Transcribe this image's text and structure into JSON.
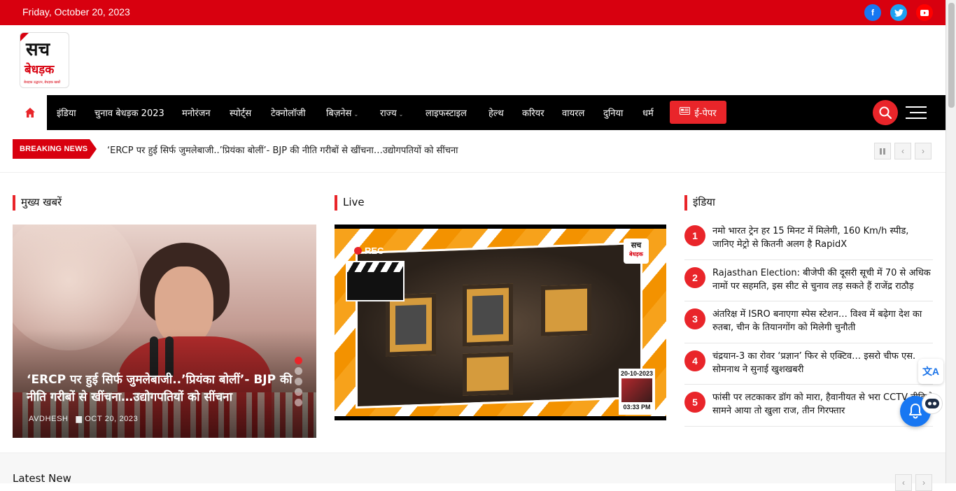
{
  "topbar": {
    "date": "Friday, October 20, 2023",
    "social": [
      {
        "icon": "facebook-icon",
        "glyph": "f",
        "color": "#1877f2"
      },
      {
        "icon": "twitter-icon",
        "glyph": "t",
        "color": "#1da1f2"
      },
      {
        "icon": "youtube-icon",
        "glyph": "▶",
        "color": "#ff0000"
      }
    ]
  },
  "logo": {
    "line1": "सच",
    "line2": "बेधड़क",
    "tagline": "बेधड़क उद्घाटन, बेधड़क खबरें"
  },
  "nav": {
    "items": [
      "इंडिया",
      "चुनाव बेधड़क 2023",
      "मनोरंजन",
      "स्पोर्ट्स",
      "टेक्नोलॉजी",
      "बिज़नेस",
      "राज्य",
      "लाइफस्टाइल",
      "हेल्थ",
      "करियर",
      "वायरल",
      "दुनिया",
      "धर्म"
    ],
    "epaper": "ई-पेपर",
    "accent": "#e9252a"
  },
  "breaking": {
    "label": "BREAKING NEWS",
    "text": "‘ERCP पर हुई सिर्फ जुमलेबाजी..’प्रियंका बोलीं’- BJP की नीति गरीबों से खींचना…उद्योगपतियों को सींचना"
  },
  "sections": {
    "main": "मुख्य खबरें",
    "live": "Live",
    "india": "इंडिया"
  },
  "hero": {
    "title": "‘ERCP पर हुई सिर्फ जुमलेबाजी..’प्रियंका बोलीं’- BJP की नीति गरीबों से खींचना…उद्योगपतियों को सींचना",
    "author": "AVDHESH",
    "date": "OCT 20, 2023"
  },
  "live": {
    "rec": "REC",
    "badge_line1": "सच",
    "badge_line2": "बेधड़क",
    "stamp_date": "20-10-2023",
    "stamp_time": "03:33 PM"
  },
  "india_list": [
    {
      "num": "1",
      "text": "नमो भारत ट्रेन हर 15 मिनट में मिलेगी, 160 Km/h स्पीड, जानिए मेट्रो से कितनी अलग है RapidX"
    },
    {
      "num": "2",
      "text": "Rajasthan Election: बीजेपी की दूसरी सूची में 70 से अधिक नामों पर सहमति, इस सीट से चुनाव लड़ सकते हैं राजेंद्र राठौड़"
    },
    {
      "num": "3",
      "text": "अंतरिक्ष में ISRO बनाएगा स्पेस स्टेशन… विश्व में बढ़ेगा देश का रुतबा, चीन के तियानगोंग को मिलेगी चुनौती"
    },
    {
      "num": "4",
      "text": "चंद्रयान-3 का रोवर ‘प्रज्ञान’ फिर से एक्टिव… इसरो चीफ एस. सोमनाथ ने सुनाई खुशखबरी"
    },
    {
      "num": "5",
      "text": "फांसी पर लटकाकर डॉग को मारा, हैवानीयत से भरा CCTV वीडियो सामने आया तो खुला राज, तीन गिरफ्तार"
    }
  ],
  "latest": {
    "title": "Latest New"
  }
}
